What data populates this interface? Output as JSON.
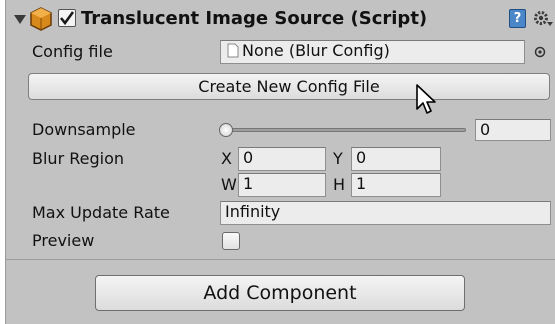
{
  "header": {
    "title": "Translucent Image Source (Script)",
    "enabled": true,
    "icons": [
      "foldout-arrow-icon",
      "script-component-icon",
      "help-book-icon",
      "gear-icon"
    ]
  },
  "fields": {
    "config_file": {
      "label": "Config file",
      "value": "None (Blur Config)"
    },
    "create_button": "Create New Config File",
    "downsample": {
      "label": "Downsample",
      "value": "0",
      "slider_fraction": 0
    },
    "blur_region": {
      "label": "Blur Region",
      "x_label": "X",
      "x_value": "0",
      "y_label": "Y",
      "y_value": "0",
      "w_label": "W",
      "w_value": "1",
      "h_label": "H",
      "h_value": "1"
    },
    "max_update_rate": {
      "label": "Max Update Rate",
      "value": "Infinity"
    },
    "preview": {
      "label": "Preview",
      "checked": false
    }
  },
  "footer": {
    "add_component": "Add Component"
  },
  "colors": {
    "panel_bg": "#c2c2c2",
    "field_bg": "#ececec",
    "help_icon_blue": "#4a86c8",
    "component_icon_orange": "#d8891c"
  }
}
